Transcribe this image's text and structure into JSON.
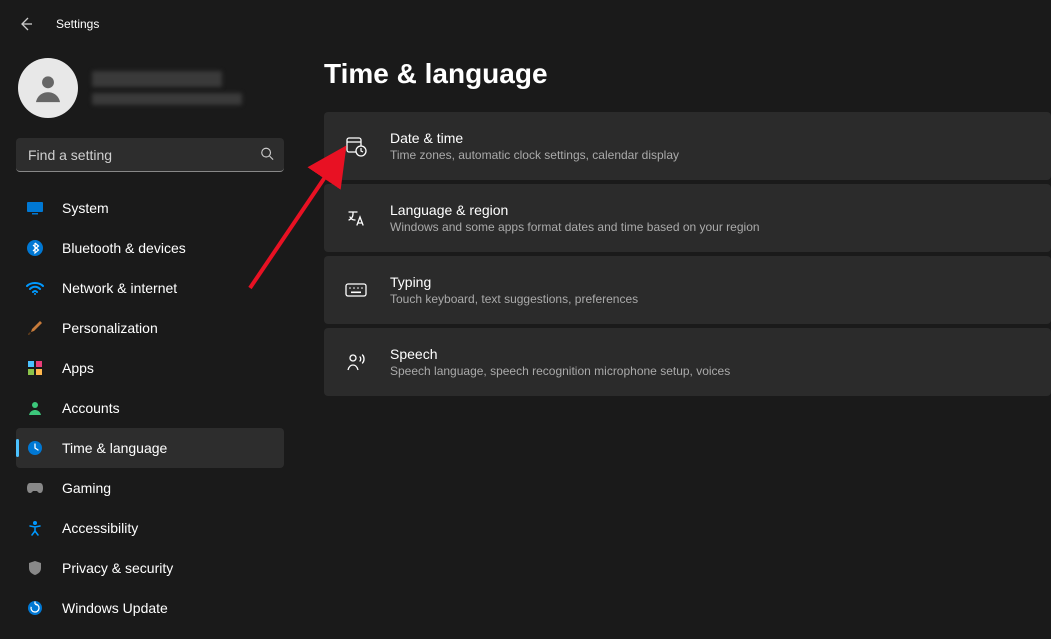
{
  "titlebar": {
    "title": "Settings"
  },
  "search": {
    "placeholder": "Find a setting"
  },
  "nav": {
    "items": [
      {
        "label": "System"
      },
      {
        "label": "Bluetooth & devices"
      },
      {
        "label": "Network & internet"
      },
      {
        "label": "Personalization"
      },
      {
        "label": "Apps"
      },
      {
        "label": "Accounts"
      },
      {
        "label": "Time & language"
      },
      {
        "label": "Gaming"
      },
      {
        "label": "Accessibility"
      },
      {
        "label": "Privacy & security"
      },
      {
        "label": "Windows Update"
      }
    ]
  },
  "page": {
    "title": "Time & language",
    "cards": [
      {
        "title": "Date & time",
        "sub": "Time zones, automatic clock settings, calendar display"
      },
      {
        "title": "Language & region",
        "sub": "Windows and some apps format dates and time based on your region"
      },
      {
        "title": "Typing",
        "sub": "Touch keyboard, text suggestions, preferences"
      },
      {
        "title": "Speech",
        "sub": "Speech language, speech recognition microphone setup, voices"
      }
    ]
  }
}
